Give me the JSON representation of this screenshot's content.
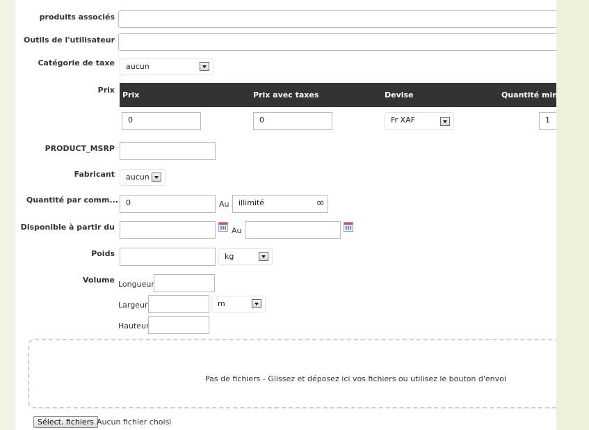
{
  "fields": {
    "associated_products": {
      "label": "produits associés",
      "value": ""
    },
    "user_tools": {
      "label": "Outils de l'utilisateur",
      "value": ""
    },
    "tax_category": {
      "label": "Catégorie de taxe",
      "value": "aucun"
    },
    "price": {
      "label": "Prix",
      "columns": [
        "Prix",
        "Prix avec taxes",
        "Devise",
        "Quantité minim"
      ],
      "price_value": "0",
      "price_tax_value": "0",
      "currency": "Fr XAF",
      "min_qty": "1"
    },
    "msrp": {
      "label": "PRODUCT_MSRP",
      "value": ""
    },
    "manufacturer": {
      "label": "Fabricant",
      "value": "aucun"
    },
    "order_qty": {
      "label": "Quantité par comm...",
      "from": "0",
      "to_label": "Au",
      "to": "illimité",
      "infinity": "∞"
    },
    "available_from": {
      "label": "Disponible à partir du",
      "from": "",
      "to_label": "Au",
      "to": "",
      "calendar_icon": "calendar-icon"
    },
    "weight": {
      "label": "Poids",
      "value": "",
      "unit": "kg"
    },
    "volume": {
      "label": "Volume",
      "length_label": "Longueur",
      "length": "",
      "width_label": "Largeur",
      "width": "",
      "unit": "m",
      "height_label": "Hauteur",
      "height": ""
    }
  },
  "upload": {
    "drop_message": "Pas de fichiers - Glissez et déposez ici vos fichiers ou utilisez le bouton d'envoi",
    "button_label": "Sélect. fichiers",
    "status": "Aucun fichier choisi"
  },
  "colors": {
    "page_bg": "#f2f4e4",
    "header_bg": "#333333",
    "panel_bg": "#ffffff"
  }
}
